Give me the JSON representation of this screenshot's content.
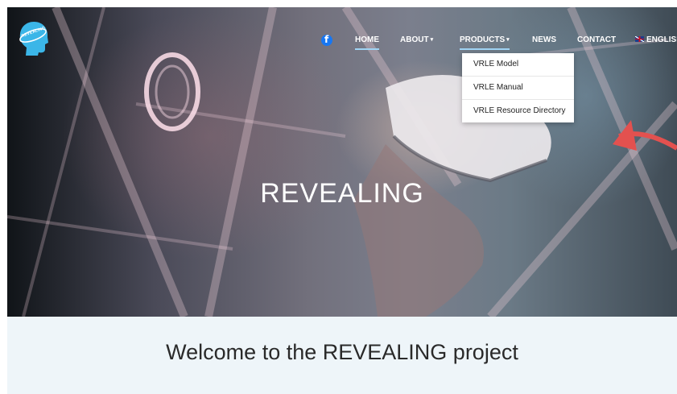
{
  "logo": {
    "text": "REVEALING"
  },
  "nav": {
    "facebook_icon": "facebook-icon",
    "items": [
      {
        "label": "HOME",
        "active": true,
        "has_caret": false
      },
      {
        "label": "ABOUT",
        "active": false,
        "has_caret": true
      },
      {
        "label": "PRODUCTS",
        "active": true,
        "has_caret": true
      },
      {
        "label": "NEWS",
        "active": false,
        "has_caret": false
      },
      {
        "label": "CONTACT",
        "active": false,
        "has_caret": false
      },
      {
        "label": "ENGLISH",
        "active": false,
        "has_caret": false,
        "icon": "uk-flag-icon"
      }
    ]
  },
  "dropdown": {
    "items": [
      {
        "label": "VRLE Model"
      },
      {
        "label": "VRLE Manual"
      },
      {
        "label": "VRLE Resource Directory"
      }
    ]
  },
  "hero": {
    "title": "REVEALING"
  },
  "welcome": {
    "heading": "Welcome to the REVEALING project"
  },
  "colors": {
    "logo_bg": "#3bb6e8",
    "active_underline": "#9fd3f3",
    "facebook": "#1877f2",
    "welcome_bg": "#eef5f9"
  }
}
